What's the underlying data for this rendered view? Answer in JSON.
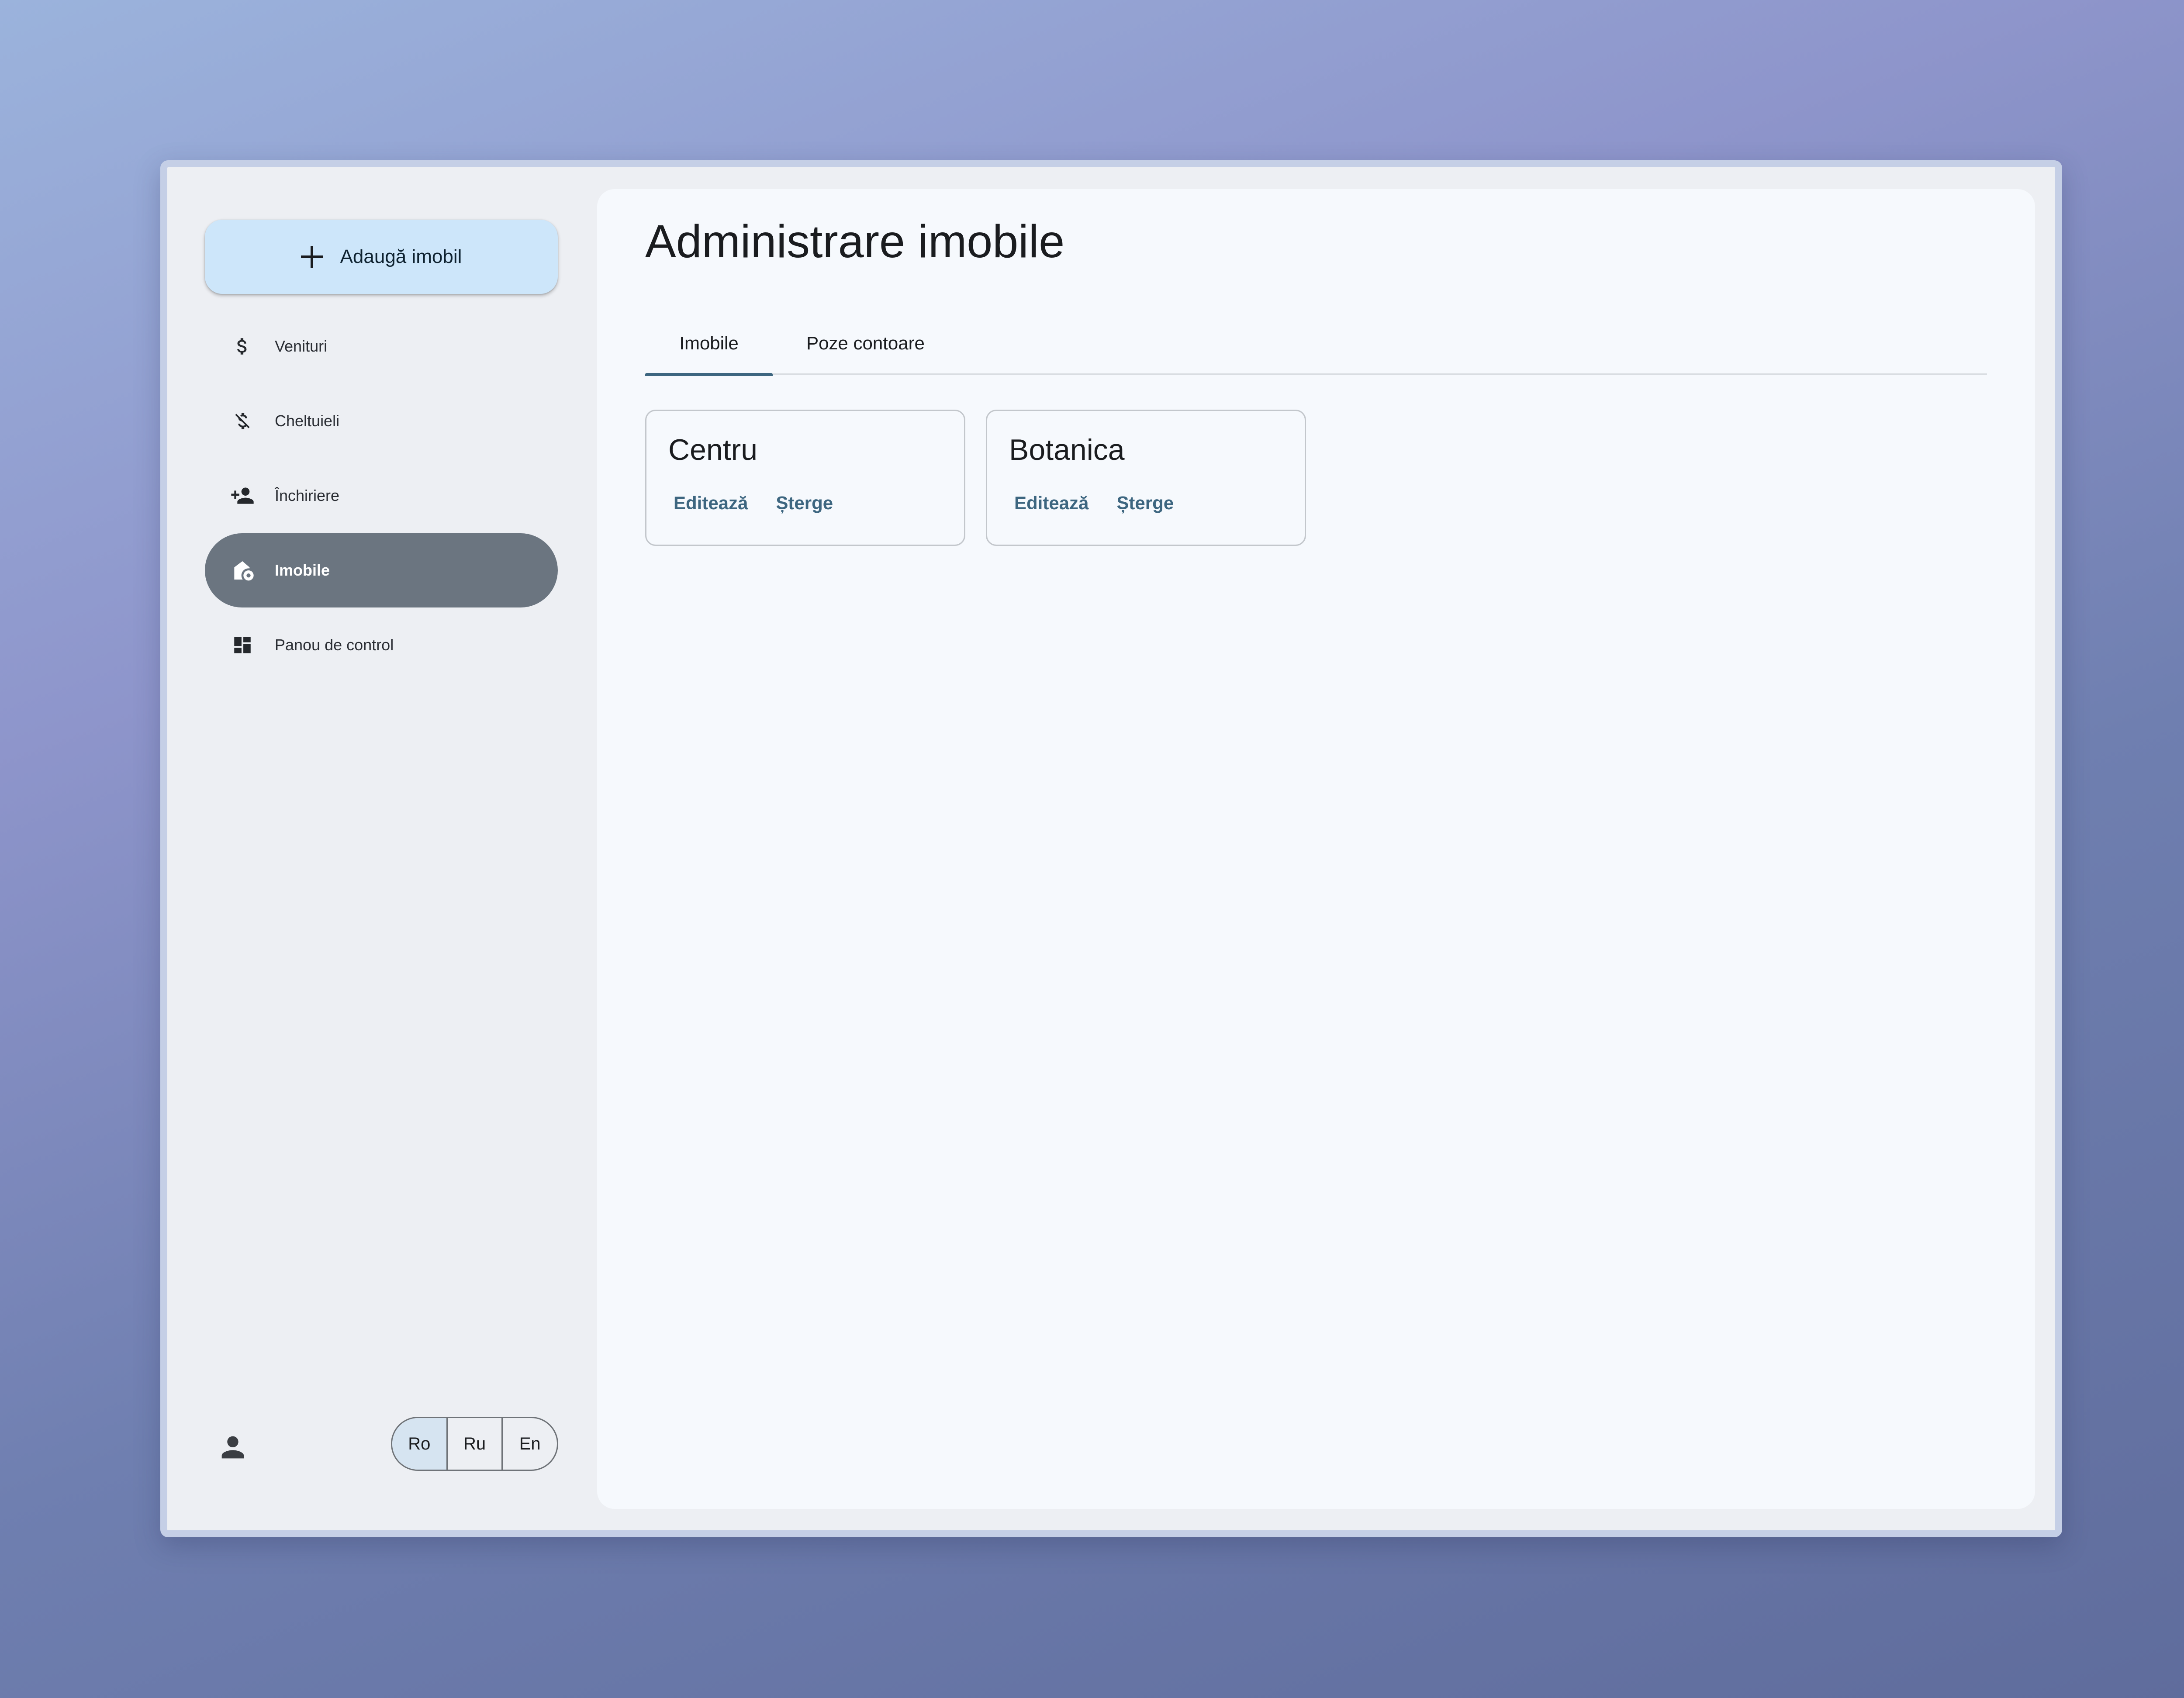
{
  "sidebar": {
    "add_button": {
      "label": "Adaugă imobil",
      "icon": "plus-icon"
    },
    "items": [
      {
        "label": "Venituri",
        "icon": "dollar-icon",
        "active": false
      },
      {
        "label": "Cheltuieli",
        "icon": "money-off-icon",
        "active": false
      },
      {
        "label": "Închiriere",
        "icon": "person-add-icon",
        "active": false
      },
      {
        "label": "Imobile",
        "icon": "home-settings-icon",
        "active": true
      },
      {
        "label": "Panou de control",
        "icon": "dashboard-icon",
        "active": false
      }
    ],
    "account_icon": "person-icon",
    "languages": [
      {
        "label": "Ro",
        "selected": true
      },
      {
        "label": "Ru",
        "selected": false
      },
      {
        "label": "En",
        "selected": false
      }
    ]
  },
  "main": {
    "title": "Administrare imobile",
    "tabs": [
      {
        "label": "Imobile",
        "active": true
      },
      {
        "label": "Poze contoare",
        "active": false
      }
    ],
    "cards": [
      {
        "title": "Centru",
        "edit_label": "Editează",
        "delete_label": "Șterge"
      },
      {
        "title": "Botanica",
        "edit_label": "Editează",
        "delete_label": "Șterge"
      }
    ]
  },
  "colors": {
    "accent": "#3d6680",
    "active_nav": "#6b7580",
    "add_button_bg": "#cde6fa",
    "selected_lang_bg": "#d6e4f1"
  }
}
